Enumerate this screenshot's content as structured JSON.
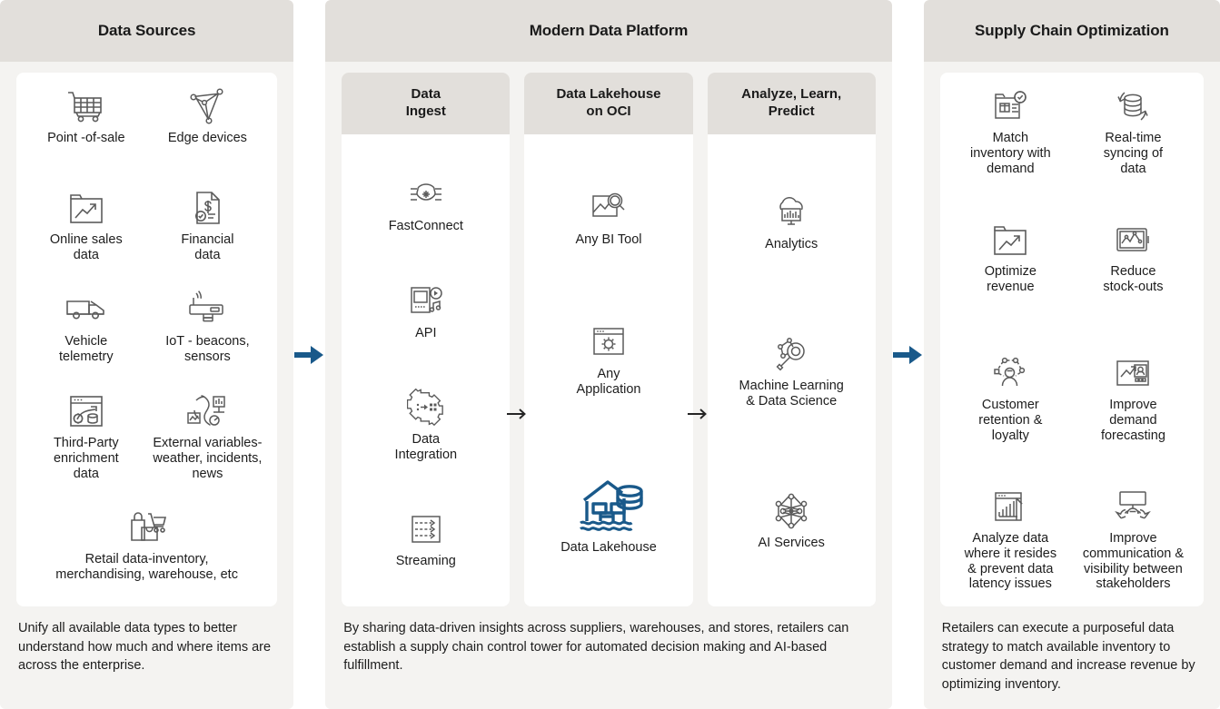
{
  "panels": {
    "left": {
      "title": "Data Sources",
      "items": [
        {
          "icon": "shopping-cart-icon",
          "label": "Point -of-sale"
        },
        {
          "icon": "edge-devices-network-icon",
          "label": "Edge devices"
        },
        {
          "icon": "online-sales-chart-folder-icon",
          "label": "Online sales\ndata"
        },
        {
          "icon": "financial-document-dollar-icon",
          "label": "Financial\ndata"
        },
        {
          "icon": "delivery-van-icon",
          "label": "Vehicle\ntelemetry"
        },
        {
          "icon": "iot-sensor-beacon-icon",
          "label": "IoT - beacons,\nsensors"
        },
        {
          "icon": "third-party-enrichment-icon",
          "label": "Third-Party\nenrichment\ndata"
        },
        {
          "icon": "external-variables-icon",
          "label": "External variables-\nweather, incidents,\nnews"
        },
        {
          "icon": "retail-inventory-cart-bag-icon",
          "label": "Retail data-inventory,\nmerchandising, warehouse, etc"
        }
      ],
      "caption": "Unify all available data types to better understand how much and where items are across the enterprise."
    },
    "mid": {
      "title": "Modern Data Platform",
      "columns": [
        {
          "heading": "Data\nIngest",
          "items": [
            {
              "icon": "fastconnect-node-icon",
              "label": "FastConnect"
            },
            {
              "icon": "api-device-media-icon",
              "label": "API"
            },
            {
              "icon": "data-integration-gear-icon",
              "label": "Data\nIntegration"
            },
            {
              "icon": "streaming-arrows-icon",
              "label": "Streaming"
            }
          ]
        },
        {
          "heading": "Data Lakehouse\non OCI",
          "items": [
            {
              "icon": "any-bi-tool-magnifier-chart-icon",
              "label": "Any BI Tool"
            },
            {
              "icon": "any-application-window-gear-icon",
              "label": "Any\nApplication"
            },
            {
              "icon": "data-lakehouse-icon",
              "label": "Data Lakehouse"
            }
          ]
        },
        {
          "heading": "Analyze, Learn,\nPredict",
          "items": [
            {
              "icon": "analytics-cloud-chart-icon",
              "label": "Analytics"
            },
            {
              "icon": "machine-learning-magnifier-nodes-icon",
              "label": "Machine Learning\n& Data Science"
            },
            {
              "icon": "ai-services-neural-net-icon",
              "label": "AI Services"
            }
          ]
        }
      ],
      "caption": "By sharing data-driven insights across suppliers, warehouses, and stores, retailers can establish a supply chain control tower for automated decision making and AI-based fulfillment."
    },
    "right": {
      "title": "Supply Chain Optimization",
      "items": [
        {
          "icon": "match-inventory-check-icon",
          "label": "Match\ninventory with\ndemand"
        },
        {
          "icon": "realtime-sync-database-icon",
          "label": "Real-time\nsyncing of\ndata"
        },
        {
          "icon": "optimize-revenue-chart-icon",
          "label": "Optimize\nrevenue"
        },
        {
          "icon": "reduce-stockouts-screen-icon",
          "label": "Reduce\nstock-outs"
        },
        {
          "icon": "customer-retention-loyalty-icon",
          "label": "Customer\nretention &\nloyalty"
        },
        {
          "icon": "improve-demand-forecasting-icon",
          "label": "Improve\ndemand\nforecasting"
        },
        {
          "icon": "analyze-data-bar-growth-icon",
          "label": "Analyze data\nwhere it resides\n& prevent data\nlatency issues"
        },
        {
          "icon": "improve-communication-presentation-icon",
          "label": "Improve\ncommunication &\nvisibility between\nstakeholders"
        }
      ],
      "caption": "Retailers can execute a purposeful data strategy to match available inventory to customer demand and increase revenue by optimizing inventory."
    }
  },
  "flow_arrows": [
    {
      "name": "arrow-sources-to-platform",
      "style": "primary-blue"
    },
    {
      "name": "arrow-ingest-to-lakehouse",
      "style": "dark-thin"
    },
    {
      "name": "arrow-lakehouse-to-analyze",
      "style": "dark-thin"
    },
    {
      "name": "arrow-platform-to-optimization",
      "style": "primary-blue"
    }
  ],
  "colors": {
    "panel_header_bg": "#e2dfdb",
    "panel_bg": "#f4f3f1",
    "card_bg": "#ffffff",
    "icon_stroke": "#5b5b5b",
    "accent_blue": "#19598a",
    "text": "#1d1d1d"
  }
}
